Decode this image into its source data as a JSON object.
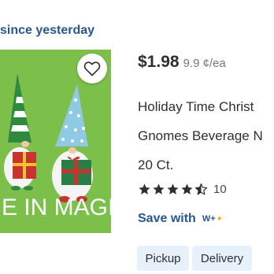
{
  "status": {
    "since_text": " since yesterday"
  },
  "product": {
    "image_text": "E IN MAGIC",
    "price": "$1.98",
    "unit_price": "9.9 ¢/ea",
    "title_lines": [
      "Holiday Time Christ",
      "Gnomes Beverage N",
      "20 Ct."
    ],
    "rating": {
      "stars": 4.5,
      "count": "10"
    },
    "save_label": "Save with",
    "membership_mark": "W+"
  },
  "fulfillment": {
    "options": [
      "Pickup",
      "Delivery"
    ]
  },
  "icons": {
    "favorite": "heart-outline-icon",
    "star": "star-icon",
    "membership": "walmart-plus-icon"
  },
  "colors": {
    "accent": "#2a5595",
    "chip_bg": "#e6f1fc",
    "image_bg": "#7cbf4a",
    "star": "#2e2f32"
  }
}
